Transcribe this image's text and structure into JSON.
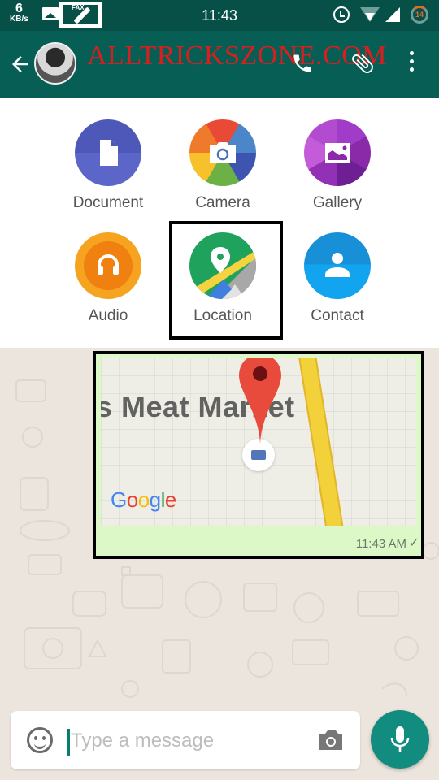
{
  "status_bar": {
    "net_speed_value": "6",
    "net_speed_unit": "KB/s",
    "fax_label": "FAX",
    "time": "11:43",
    "battery_level": "14",
    "icons": [
      "image-notification-icon",
      "fax-notification-icon",
      "alarm-icon",
      "wifi-icon",
      "cell-signal-icon",
      "battery-icon"
    ]
  },
  "app_bar": {
    "back_icon": "arrow-left-icon",
    "watermark": "ALLTRICKSZONE.COM",
    "actions": [
      "call-icon",
      "attach-icon",
      "more-vert-icon"
    ]
  },
  "attachment_sheet": {
    "items": [
      {
        "label": "Document",
        "icon": "document-icon",
        "color": "#5661c0"
      },
      {
        "label": "Camera",
        "icon": "camera-icon",
        "color": "#4b86c9"
      },
      {
        "label": "Gallery",
        "icon": "gallery-icon",
        "color": "#a13cc8"
      },
      {
        "label": "Audio",
        "icon": "headphones-icon",
        "color": "#f08010"
      },
      {
        "label": "Location",
        "icon": "map-pin-icon",
        "color": "#1fa25b"
      },
      {
        "label": "Contact",
        "icon": "person-icon",
        "color": "#12a4ef"
      }
    ],
    "highlighted": "Location"
  },
  "chat": {
    "location_message": {
      "map_label": "s Meat Market",
      "provider_logo": [
        "G",
        "o",
        "o",
        "g",
        "l",
        "e"
      ],
      "time": "11:43 AM",
      "status": "✓"
    }
  },
  "composer": {
    "placeholder": "Type a message",
    "value": ""
  },
  "colors": {
    "primary_dark": "#075048",
    "primary": "#075e54",
    "accent": "#128c7e",
    "bubble_outgoing": "#dcf8c6",
    "chat_background": "#ece5dd",
    "watermark": "#d62020"
  }
}
